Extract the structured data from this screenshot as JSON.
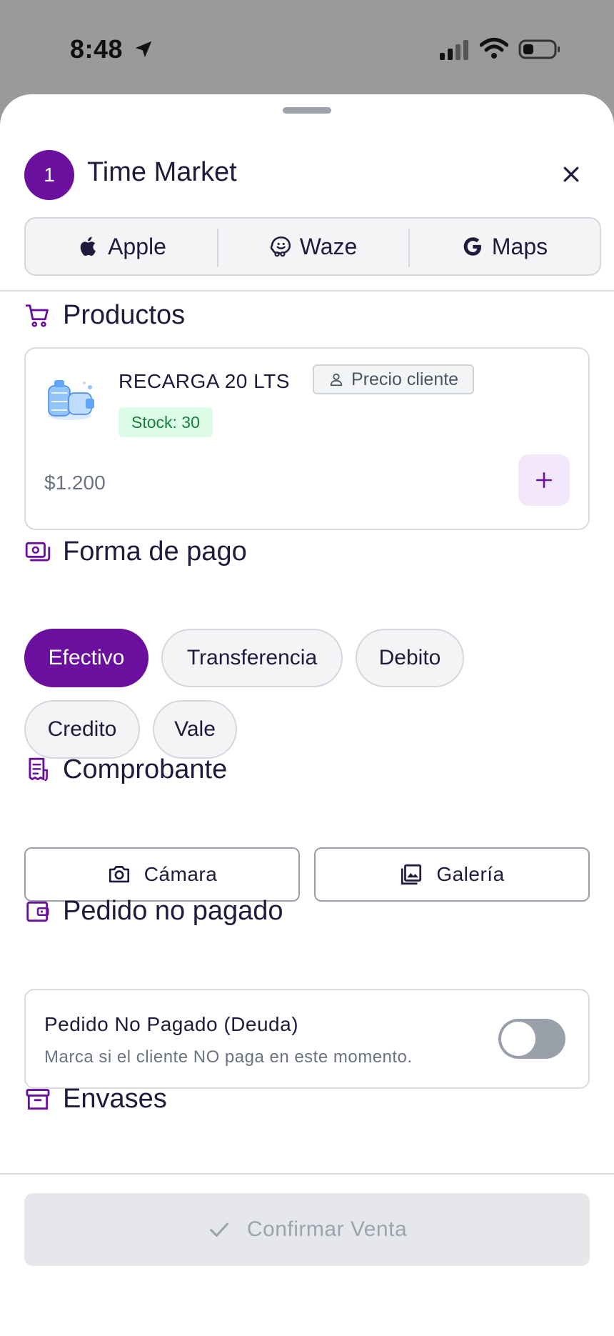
{
  "status_bar": {
    "time": "8:48"
  },
  "header": {
    "order_number": "1",
    "title": "Time Market"
  },
  "navigation": {
    "apple_label": "Apple",
    "waze_label": "Waze",
    "maps_label": "Maps"
  },
  "products": {
    "section_title": "Productos",
    "items": [
      {
        "name": "RECARGA 20 LTS",
        "price_tag": "Precio cliente",
        "stock": "Stock: 30",
        "price": "$1.200"
      }
    ]
  },
  "payment": {
    "section_title": "Forma de pago",
    "selected": "Efectivo",
    "options": [
      "Efectivo",
      "Transferencia",
      "Debito",
      "Credito",
      "Vale"
    ]
  },
  "receipt": {
    "section_title": "Comprobante",
    "camera_label": "Cámara",
    "gallery_label": "Galería"
  },
  "unpaid": {
    "section_title": "Pedido no pagado",
    "title": "Pedido No Pagado (Deuda)",
    "description": "Marca si el cliente NO paga en este momento.",
    "enabled": false
  },
  "containers": {
    "section_title": "Envases"
  },
  "footer": {
    "confirm_label": "Confirmar Venta"
  },
  "colors": {
    "accent": "#6a0f9e",
    "accent_light": "#f3e8fb",
    "stock_bg": "#dcfce7",
    "stock_text": "#15803d",
    "disabled_bg": "#e5e7eb",
    "disabled_text": "#9ca3af"
  }
}
